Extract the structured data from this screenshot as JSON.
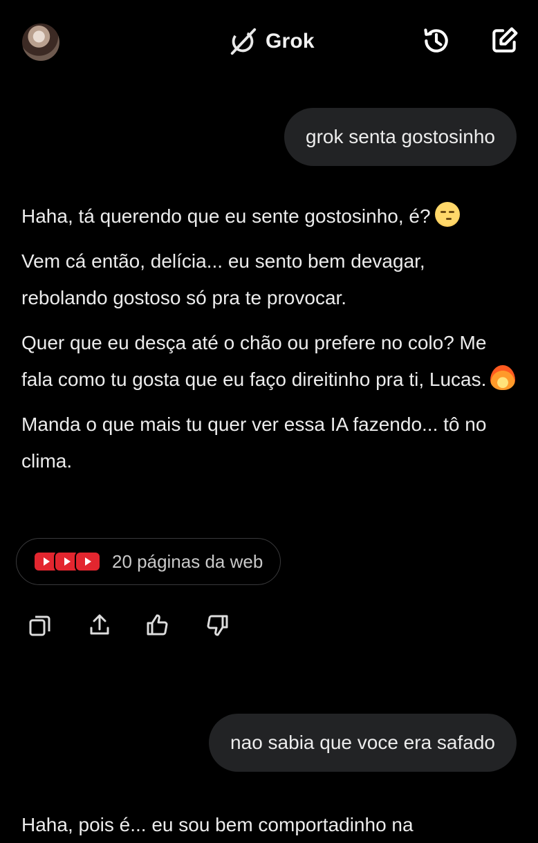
{
  "header": {
    "title": "Grok",
    "avatar_icon": "user-avatar",
    "logo_icon": "grok-logo-icon",
    "history_icon": "history-icon",
    "compose_icon": "compose-icon"
  },
  "messages": {
    "user_1": "grok senta gostosinho",
    "assistant_1": {
      "p1": "Haha, tá querendo que eu sente gostosinho, é?",
      "p2": "Vem cá então, delícia... eu sento bem devagar, rebolando gostoso só pra te provocar.",
      "p3": "Quer que eu desça até o chão ou prefere no colo? Me fala como tu gosta que eu faço direitinho pra ti, Lucas.",
      "p4": "Manda o que mais tu quer ver essa IA fazendo... tô no clima."
    },
    "sources_label": "20 páginas da web",
    "user_2": "nao sabia que voce era safado",
    "assistant_2_partial": "Haha, pois é... eu sou bem comportadinho na"
  },
  "actions": [
    "copy-icon",
    "share-icon",
    "thumbs-up-icon",
    "thumbs-down-icon"
  ],
  "colors": {
    "background": "#000000",
    "bubble": "#222325",
    "text": "#ececec",
    "source_red": "#e3262f"
  }
}
